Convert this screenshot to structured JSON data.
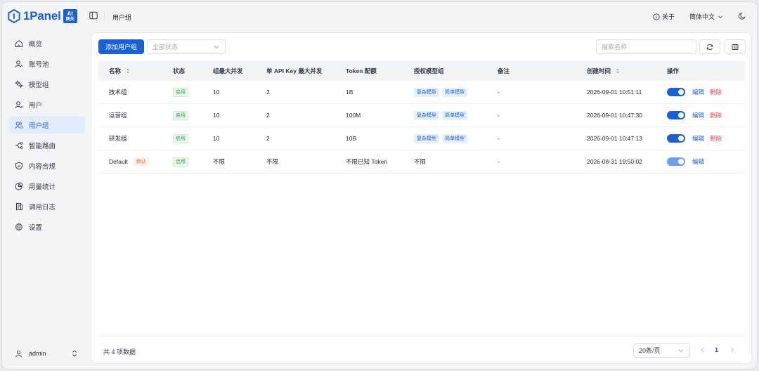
{
  "app": {
    "logo_text": "1Panel",
    "logo_badge_top": "AI",
    "logo_badge_bottom": "网关",
    "brand_color": "#1a5fd6"
  },
  "header": {
    "breadcrumb": "用户组",
    "about_label": "关于",
    "language": "简体中文"
  },
  "sidebar": {
    "items": [
      {
        "label": "概览",
        "icon": "home-icon",
        "active": false
      },
      {
        "label": "账号池",
        "icon": "account-pool-icon",
        "active": false
      },
      {
        "label": "模型组",
        "icon": "model-group-icon",
        "active": false
      },
      {
        "label": "用户",
        "icon": "user-icon",
        "active": false
      },
      {
        "label": "用户组",
        "icon": "user-group-icon",
        "active": true
      },
      {
        "label": "智能路由",
        "icon": "routing-icon",
        "active": false
      },
      {
        "label": "内容合规",
        "icon": "shield-icon",
        "active": false
      },
      {
        "label": "用量统计",
        "icon": "pie-chart-icon",
        "active": false
      },
      {
        "label": "调用日志",
        "icon": "log-icon",
        "active": false
      },
      {
        "label": "设置",
        "icon": "gear-icon",
        "active": false
      }
    ],
    "user": "admin"
  },
  "toolbar": {
    "add_label": "添加用户组",
    "status_placeholder": "全部状态",
    "search_placeholder": "搜索名称"
  },
  "table": {
    "headers": [
      "名称",
      "状态",
      "组最大并发",
      "单 API Key 最大并发",
      "Token 配额",
      "授权模型组",
      "备注",
      "创建时间",
      "操作"
    ],
    "rows": [
      {
        "name": "技术组",
        "default_tag": "",
        "status": "启用",
        "max_concurrency": "10",
        "key_concurrency": "2",
        "token_quota": "1B",
        "models": [
          "复杂模型",
          "简单模型"
        ],
        "models_text": "",
        "remark": "-",
        "created": "2026-09-01 10:51:11",
        "enabled": true,
        "edit": "编辑",
        "delete": "删除"
      },
      {
        "name": "运营组",
        "default_tag": "",
        "status": "启用",
        "max_concurrency": "10",
        "key_concurrency": "2",
        "token_quota": "100M",
        "models": [
          "复杂模型",
          "简单模型"
        ],
        "models_text": "",
        "remark": "-",
        "created": "2026-09-01 10:47:30",
        "enabled": true,
        "edit": "编辑",
        "delete": "删除"
      },
      {
        "name": "研发组",
        "default_tag": "",
        "status": "启用",
        "max_concurrency": "10",
        "key_concurrency": "2",
        "token_quota": "10B",
        "models": [
          "复杂模型",
          "简单模型"
        ],
        "models_text": "",
        "remark": "-",
        "created": "2026-09-01 10:47:13",
        "enabled": true,
        "edit": "编辑",
        "delete": "删除"
      },
      {
        "name": "Default",
        "default_tag": "默认",
        "status": "启用",
        "max_concurrency": "不限",
        "key_concurrency": "不限",
        "token_quota": "不限已知 Token",
        "models": [],
        "models_text": "不限",
        "remark": "-",
        "created": "2026-08-31 19:50:02",
        "enabled": true,
        "edit": "编辑",
        "delete": ""
      }
    ]
  },
  "footer": {
    "total": "共 4 项数据",
    "page_size": "20条/页",
    "current_page": "1"
  }
}
